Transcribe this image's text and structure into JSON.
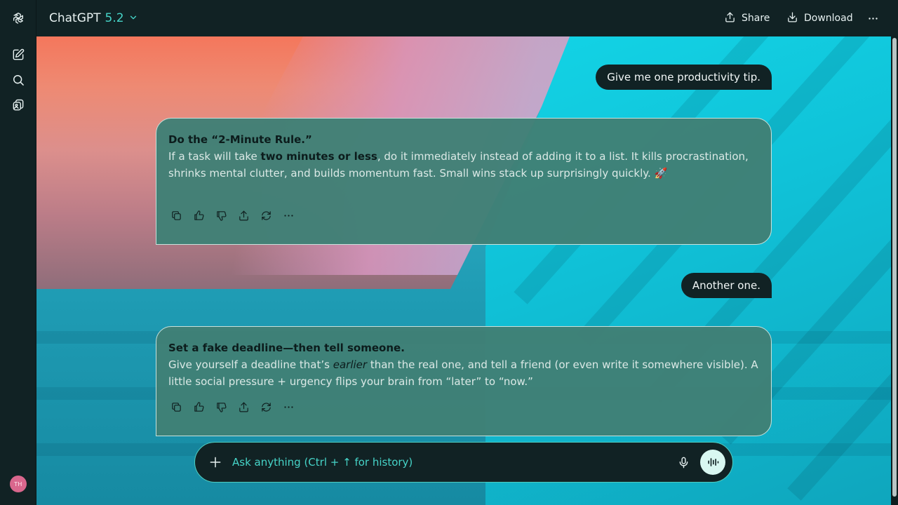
{
  "header": {
    "app_name": "ChatGPT",
    "model_version": "5.2",
    "share_label": "Share",
    "download_label": "Download"
  },
  "sidebar": {
    "icons": [
      "logo-icon",
      "new-chat-icon",
      "search-icon",
      "library-icon"
    ],
    "avatar_initials": "TH"
  },
  "conversation": [
    {
      "role": "user",
      "text": "Give me one productivity tip."
    },
    {
      "role": "assistant",
      "heading": "Do the “2-Minute Rule.”",
      "body_before": "If a task will take ",
      "body_bold": "two minutes or less",
      "body_after": ", do it immediately instead of adding it to a list. It kills procrastination, shrinks mental clutter, and builds momentum fast. Small wins stack up surprisingly quickly. 🚀"
    },
    {
      "role": "user",
      "text": "Another one."
    },
    {
      "role": "assistant",
      "heading": "Set a fake deadline—then tell someone.",
      "body_before": "Give yourself a deadline that’s ",
      "body_italic": "earlier",
      "body_after": " than the real one, and tell a friend (or even write it somewhere visible). A little social pressure + urgency flips your brain from “later” to “now.”"
    }
  ],
  "message_actions": [
    "copy-icon",
    "thumbs-up-icon",
    "thumbs-down-icon",
    "share-icon",
    "regenerate-icon",
    "more-icon"
  ],
  "composer": {
    "placeholder": "Ask anything (Ctrl + ↑ for history)"
  },
  "colors": {
    "accent": "#46d4c8",
    "bar_bg": "#112224",
    "card_bg": "#408076",
    "avatar": "#d9678d"
  }
}
